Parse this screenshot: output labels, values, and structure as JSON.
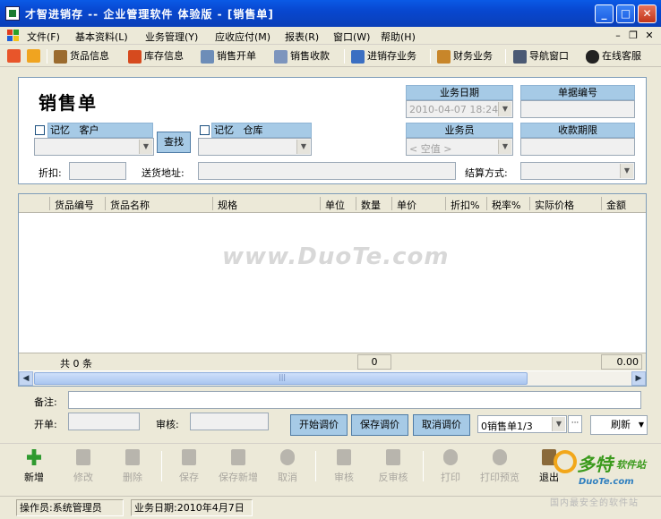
{
  "window": {
    "title": "才智进销存 -- 企业管理软件  体验版 - [销售单]",
    "btn_min": "_",
    "btn_max": "□",
    "btn_close": "✕"
  },
  "menu": {
    "items": [
      {
        "label": "文件(F)"
      },
      {
        "label": "基本资料(L)"
      },
      {
        "label": "业务管理(Y)"
      },
      {
        "label": "应收应付(M)"
      },
      {
        "label": "报表(R)"
      },
      {
        "label": "窗口(W)"
      },
      {
        "label": "帮助(H)"
      }
    ],
    "mdi_min": "–",
    "mdi_restore": "❐",
    "mdi_close": "✕"
  },
  "toolbar": {
    "items": [
      {
        "label": "货品信息"
      },
      {
        "label": "库存信息"
      },
      {
        "label": "销售开单"
      },
      {
        "label": "销售收款"
      },
      {
        "label": "进销存业务"
      },
      {
        "label": "财务业务"
      },
      {
        "label": "导航窗口"
      },
      {
        "label": "在线客服"
      }
    ]
  },
  "form": {
    "title": "销售单",
    "memory_label": "记忆",
    "customer_label": "客户",
    "warehouse_label": "仓库",
    "find_button": "查找",
    "biz_date_label": "业务日期",
    "biz_date_value": "2010-04-07 18:24",
    "doc_no_label": "单据编号",
    "salesman_label": "业务员",
    "salesman_value": "< 空值 >",
    "due_label": "收款期限",
    "discount_label": "折扣:",
    "address_label": "送货地址:",
    "settle_label": "结算方式:"
  },
  "grid": {
    "columns": [
      "货品编号",
      "货品名称",
      "规格",
      "单位",
      "数量",
      "单价",
      "折扣%",
      "税率%",
      "实际价格",
      "金额"
    ],
    "footer_count": "共 0 条",
    "footer_qty": "0",
    "footer_amount": "0.00",
    "scroll_grip": "|||"
  },
  "watermark": "www.DuoTe.com",
  "remarks_label": "备注:",
  "opener_label": "开单:",
  "auditor_label": "审核:",
  "price_buttons": {
    "start": "开始调价",
    "save": "保存调价",
    "cancel": "取消调价"
  },
  "doc_select": "0销售单1/3",
  "ellipsis": "···",
  "refresh": "刷新",
  "actions": [
    {
      "label": "新增",
      "enabled": true
    },
    {
      "label": "修改",
      "enabled": false
    },
    {
      "label": "删除",
      "enabled": false
    },
    {
      "label": "保存",
      "enabled": false
    },
    {
      "label": "保存新增",
      "enabled": false
    },
    {
      "label": "取消",
      "enabled": false
    },
    {
      "label": "审核",
      "enabled": false
    },
    {
      "label": "反审核",
      "enabled": false
    },
    {
      "label": "打印",
      "enabled": false
    },
    {
      "label": "打印预览",
      "enabled": false
    },
    {
      "label": "退出",
      "enabled": true
    }
  ],
  "status": {
    "operator": "操作员:系统管理员",
    "biz_date": "业务日期:2010年4月7日"
  },
  "brand": {
    "name": "多特",
    "sub": "软件站",
    "url": "DuoTe.com",
    "tagline": "国内最安全的软件站"
  },
  "colors": {
    "titlebar": "#0a5ae6",
    "header_cell": "#a6cae6",
    "brand_green": "#3a9a1c"
  }
}
